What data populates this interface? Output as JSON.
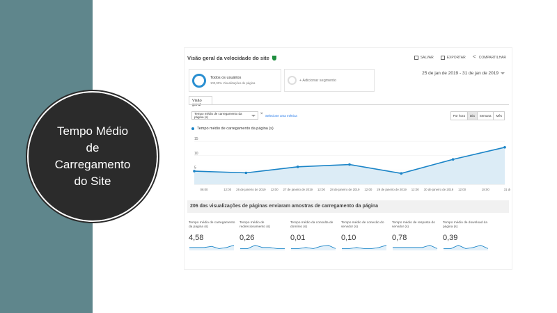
{
  "slide": {
    "title_lines": [
      "Tempo Médio",
      "de",
      "Carregamento",
      "do Site"
    ]
  },
  "colors": {
    "sidebar": "#5f868c",
    "circle": "#2b2b2b",
    "accent": "#1a84c7"
  },
  "report": {
    "title": "Visão geral da velocidade do site",
    "actions": {
      "save": "SALVAR",
      "export": "EXPORTAR",
      "share": "COMPARTILHAR"
    },
    "segment": {
      "name": "Todos os usuários",
      "sub": "100,00% Visualizações de página"
    },
    "add_segment": "+ Adicionar segmento",
    "date_range": "25 de jan de 2019 - 31 de jan de 2019",
    "tab": "Visão geral",
    "metric_select": "Tempo médio de carregamento da página (s)",
    "select_metric_link": "Selecione uma métrica",
    "granularity": [
      "Por hora",
      "Dia",
      "Semana",
      "Mês"
    ],
    "granularity_active": "Dia",
    "legend": "Tempo médio de carregamento da página (s)",
    "samples_text": "206 das visualizações de páginas enviaram amostras de carregamento da página"
  },
  "chart_data": {
    "type": "area",
    "series": [
      {
        "name": "Tempo médio de carregamento da página (s)",
        "values": [
          4.6,
          4.0,
          6.1,
          6.9,
          3.8,
          8.7,
          12.9
        ]
      }
    ],
    "x": [
      "25 de jan",
      "26 de jan",
      "27 de jan",
      "28 de jan",
      "29 de jan",
      "30 de jan",
      "31 de jan"
    ],
    "yticks": [
      "5",
      "10",
      "15"
    ],
    "ylim": [
      0,
      16
    ],
    "xtick_labels": [
      "06:00",
      "12:00",
      "26 de janeiro de 2019",
      "12:00",
      "27 de janeiro de 2019",
      "12:00",
      "28 de janeiro de 2019",
      "12:00",
      "29 de janeiro de 2019",
      "12:00",
      "30 de janeiro de 2019",
      "12:00",
      "18:00",
      "31 de..."
    ],
    "grid": true
  },
  "cards": [
    {
      "label": "Tempo médio de carregamento da página (s)",
      "value": "4,58",
      "spark": [
        3,
        3,
        3,
        2,
        4,
        3,
        1
      ]
    },
    {
      "label": "Tempo médio de redirecionamento (s)",
      "value": "0,26",
      "spark": [
        4,
        4,
        1,
        3,
        3,
        4,
        4
      ]
    },
    {
      "label": "Tempo médio da consulta de domínio (s)",
      "value": "0,01",
      "spark": [
        4,
        4,
        3,
        4,
        2,
        1,
        4
      ]
    },
    {
      "label": "Tempo médio de conexão do servidor (s)",
      "value": "0,10",
      "spark": [
        4,
        4,
        3,
        4,
        4,
        3,
        1
      ]
    },
    {
      "label": "Tempo médio de resposta do servidor (s)",
      "value": "0,78",
      "spark": [
        3,
        3,
        3,
        3,
        3,
        1,
        4
      ]
    },
    {
      "label": "Tempo médio de download da página (s)",
      "value": "0,39",
      "spark": [
        4,
        4,
        1,
        4,
        3,
        1,
        4
      ]
    }
  ]
}
